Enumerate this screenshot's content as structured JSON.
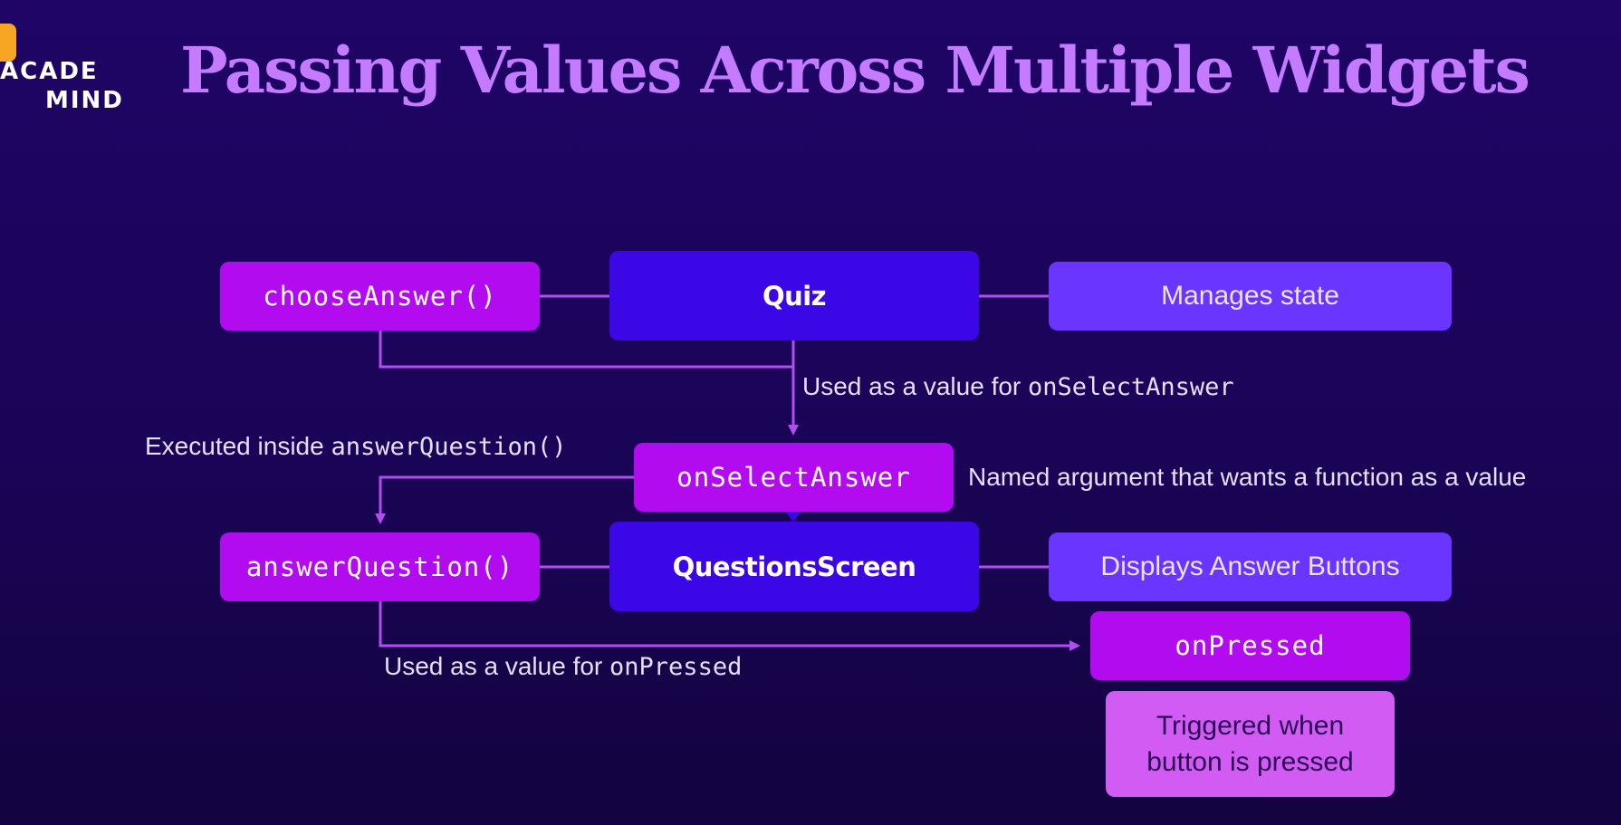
{
  "logo": {
    "line1": "ACADE",
    "line2": "MIND"
  },
  "title": "Passing Values Across Multiple Widgets",
  "nodes": {
    "choose_answer": "chooseAnswer()",
    "quiz": "Quiz",
    "manages_state": "Manages state",
    "on_select_answer": "onSelectAnswer",
    "answer_question": "answerQuestion()",
    "questions_screen": "QuestionsScreen",
    "displays_answer_buttons": "Displays Answer Buttons",
    "on_pressed": "onPressed",
    "triggered_line1": "Triggered when",
    "triggered_line2": "button is pressed"
  },
  "notes": {
    "used_value_select": {
      "text": "Used as a value for ",
      "code": "onSelectAnswer"
    },
    "executed_inside": {
      "text": "Executed inside ",
      "code": "answerQuestion()"
    },
    "named_argument": "Named argument that wants a function as a value",
    "used_value_pressed": {
      "text": "Used as a value for ",
      "code": "onPressed"
    }
  },
  "colors": {
    "background": "#1f0566",
    "title": "#c57bff",
    "function_box": "#b20bf0",
    "widget_box": "#3c07e6",
    "description_box": "#6a35ff",
    "trigger_box": "#d25cf3",
    "connector": "#b14df0",
    "logo_accent": "#f6a623"
  },
  "icons": {
    "logo_mark": "academind-logo-mark"
  }
}
